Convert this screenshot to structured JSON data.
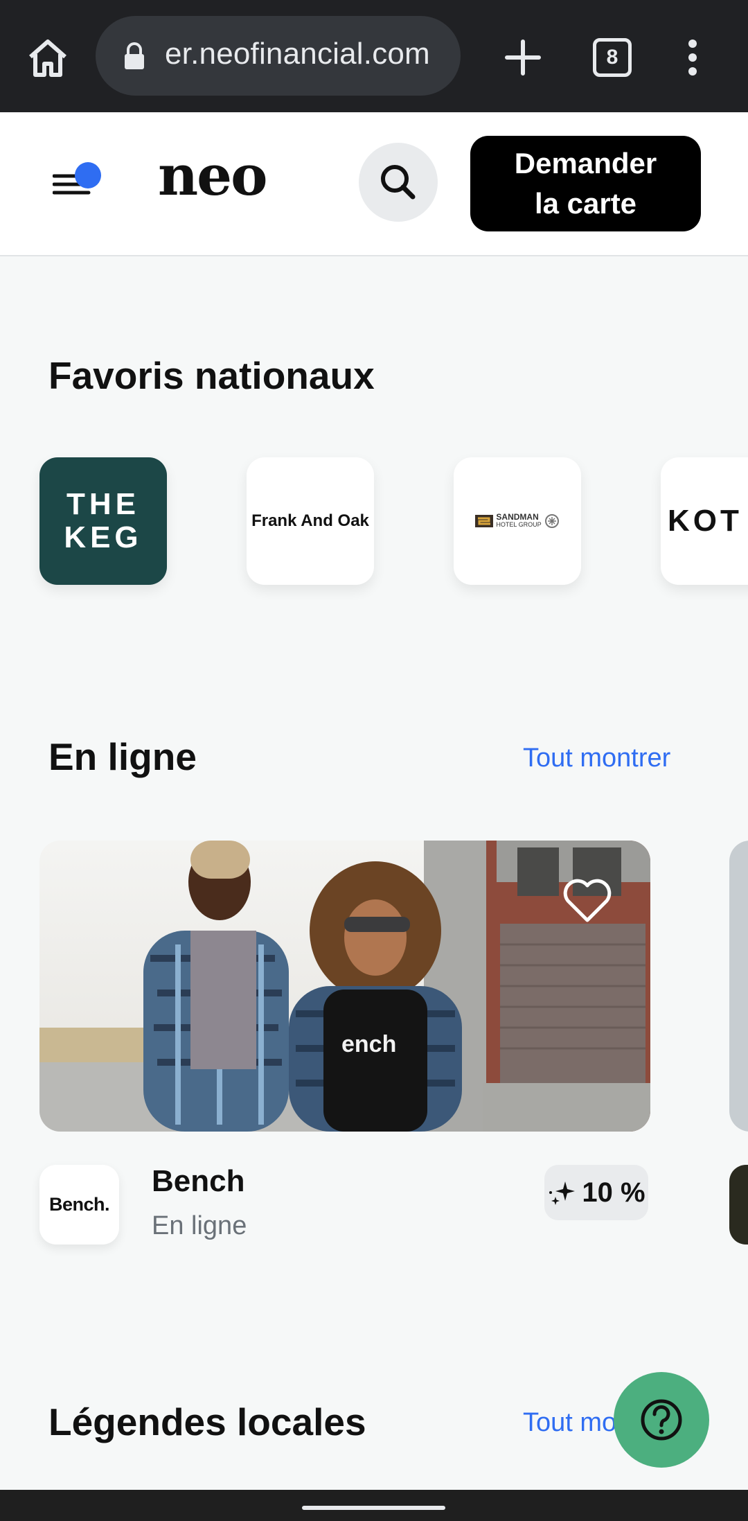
{
  "browser": {
    "url": "er.neofinancial.com",
    "tab_count": "8"
  },
  "header": {
    "logo": "neo",
    "cta_label_line1": "Demander",
    "cta_label_line2": "la carte"
  },
  "national_favorites": {
    "title": "Favoris nationaux",
    "brands": [
      {
        "name_line1": "THE",
        "name_line2": "KEG"
      },
      {
        "name": "Frank And Oak"
      },
      {
        "name": "SANDMAN",
        "sub": "HOTEL GROUP"
      },
      {
        "name": "KOT"
      }
    ]
  },
  "online": {
    "title": "En ligne",
    "see_all": "Tout montrer",
    "offer": {
      "name": "Bench",
      "category": "En ligne",
      "logo_text": "Bench.",
      "shirt_text": "ench",
      "reward": "10 %"
    }
  },
  "local_legends": {
    "title": "Légendes locales",
    "see_all": "Tout mo"
  },
  "colors": {
    "accent": "#2f6df2",
    "help_button": "#4caf7f",
    "keg_tile": "#1c4747"
  }
}
